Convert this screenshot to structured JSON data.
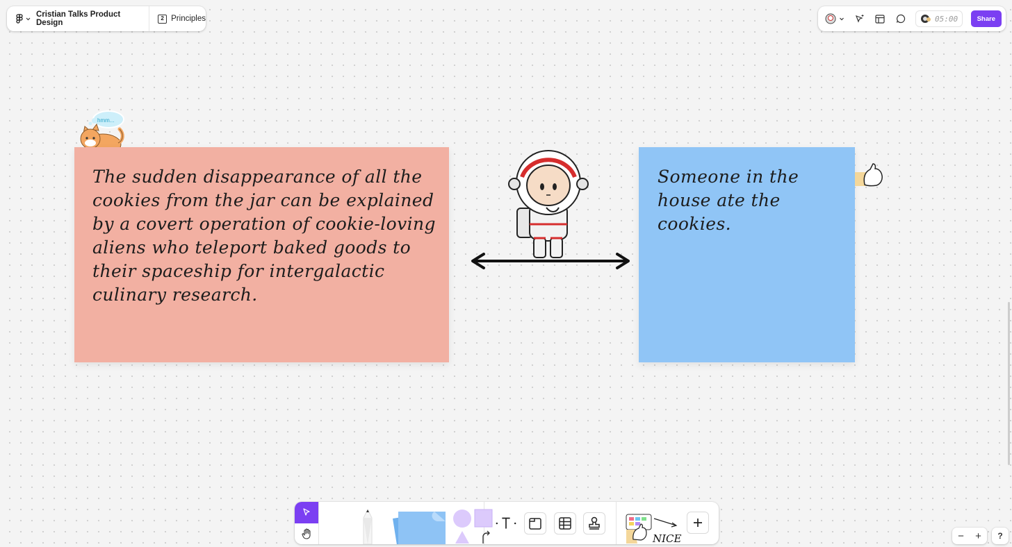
{
  "header": {
    "file_name": "Cristian Talks Product Design",
    "page_number": "2",
    "page_name": "Principles"
  },
  "topbar": {
    "timer": "05:00",
    "share_label": "Share"
  },
  "canvas": {
    "sticky_pink": {
      "text": "The sudden disappearance of all the cookies from the jar can be explained by a covert operation of cookie-loving aliens who teleport baked goods to their spaceship for intergalactic culinary research.",
      "color": "#f2b0a2"
    },
    "sticky_blue": {
      "text": "Someone in the house ate the cookies.",
      "color": "#90c5f6"
    },
    "cat_thought": "hmm...",
    "stickers": [
      "cat-sticker",
      "astronaut-sticker",
      "double-arrow",
      "peeking-hand-sticker"
    ]
  },
  "toolbar": {
    "tools": [
      "move-tool",
      "hand-tool",
      "pen-tool",
      "sticky-note-tool",
      "shapes-tool",
      "text-tool",
      "section-tool",
      "table-tool",
      "stamp-tool",
      "widgets",
      "more-tools"
    ],
    "widget_label": "NICE"
  },
  "zoom": {
    "minus": "−",
    "plus": "+"
  },
  "help": "?",
  "colors": {
    "accent": "#7b3ff2",
    "pink_sticky": "#f2b0a2",
    "blue_sticky": "#90c5f6"
  }
}
